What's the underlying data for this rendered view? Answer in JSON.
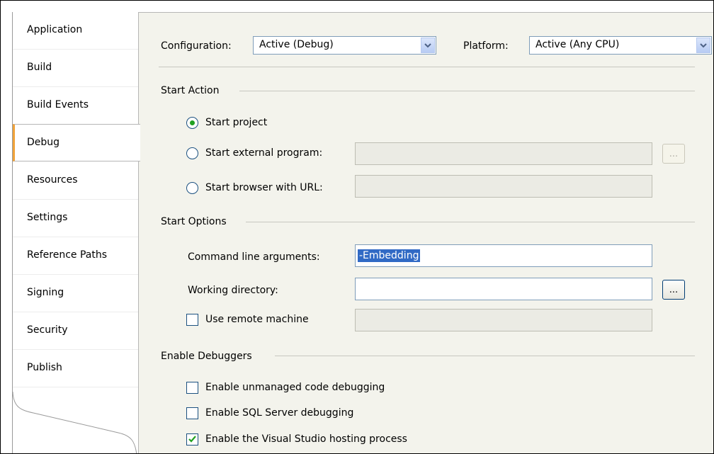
{
  "sidebar": {
    "items": [
      {
        "label": "Application"
      },
      {
        "label": "Build"
      },
      {
        "label": "Build Events"
      },
      {
        "label": "Debug",
        "active": true
      },
      {
        "label": "Resources"
      },
      {
        "label": "Settings"
      },
      {
        "label": "Reference Paths"
      },
      {
        "label": "Signing"
      },
      {
        "label": "Security"
      },
      {
        "label": "Publish"
      }
    ]
  },
  "header": {
    "configuration_label": "Configuration:",
    "configuration_value": "Active (Debug)",
    "platform_label": "Platform:",
    "platform_value": "Active (Any CPU)"
  },
  "start_action": {
    "title": "Start Action",
    "start_project": "Start project",
    "start_external": "Start external program:",
    "start_browser": "Start browser with URL:",
    "browse_label": "...",
    "selected": "start_project"
  },
  "start_options": {
    "title": "Start Options",
    "cmd_args_label": "Command line arguments:",
    "cmd_args_value": "-Embedding",
    "working_dir_label": "Working directory:",
    "working_dir_value": "",
    "browse_label": "...",
    "remote_label": "Use remote machine",
    "remote_checked": false
  },
  "debuggers": {
    "title": "Enable Debuggers",
    "unmanaged": "Enable unmanaged code debugging",
    "unmanaged_checked": false,
    "sql": "Enable SQL Server debugging",
    "sql_checked": false,
    "hosting": "Enable the Visual Studio hosting process",
    "hosting_checked": true
  },
  "colors": {
    "active_tab_accent": "#f0a23a",
    "panel_bg": "#f3f3ec",
    "radio_dot": "#21a121",
    "selection": "#316ac5"
  }
}
